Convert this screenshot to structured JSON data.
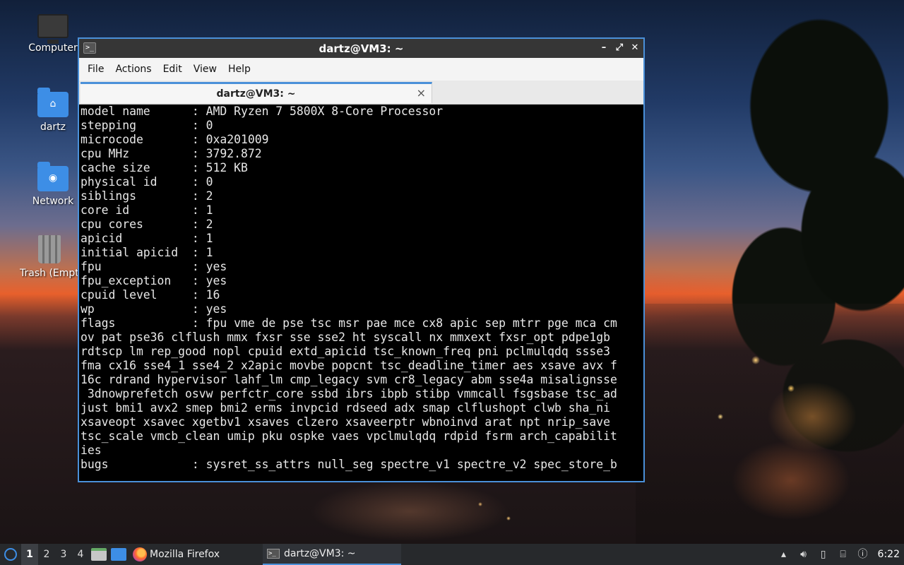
{
  "desktop": {
    "icons": [
      {
        "label": "Computer",
        "icon": "computer-icon"
      },
      {
        "label": "dartz",
        "icon": "home-folder-icon"
      },
      {
        "label": "Network",
        "icon": "network-folder-icon"
      },
      {
        "label": "Trash (Empty)",
        "icon": "trash-icon"
      }
    ]
  },
  "window": {
    "title": "dartz@VM3: ~",
    "menus": [
      "File",
      "Actions",
      "Edit",
      "View",
      "Help"
    ],
    "tab_label": "dartz@VM3: ~",
    "terminal_lines": [
      "model name      : AMD Ryzen 7 5800X 8-Core Processor",
      "stepping        : 0",
      "microcode       : 0xa201009",
      "cpu MHz         : 3792.872",
      "cache size      : 512 KB",
      "physical id     : 0",
      "siblings        : 2",
      "core id         : 1",
      "cpu cores       : 2",
      "apicid          : 1",
      "initial apicid  : 1",
      "fpu             : yes",
      "fpu_exception   : yes",
      "cpuid level     : 16",
      "wp              : yes",
      "flags           : fpu vme de pse tsc msr pae mce cx8 apic sep mtrr pge mca cm",
      "ov pat pse36 clflush mmx fxsr sse sse2 ht syscall nx mmxext fxsr_opt pdpe1gb",
      "rdtscp lm rep_good nopl cpuid extd_apicid tsc_known_freq pni pclmulqdq ssse3",
      "fma cx16 sse4_1 sse4_2 x2apic movbe popcnt tsc_deadline_timer aes xsave avx f",
      "16c rdrand hypervisor lahf_lm cmp_legacy svm cr8_legacy abm sse4a misalignsse",
      " 3dnowprefetch osvw perfctr_core ssbd ibrs ibpb stibp vmmcall fsgsbase tsc_ad",
      "just bmi1 avx2 smep bmi2 erms invpcid rdseed adx smap clflushopt clwb sha_ni",
      "xsaveopt xsavec xgetbv1 xsaves clzero xsaveerptr wbnoinvd arat npt nrip_save",
      "tsc_scale vmcb_clean umip pku ospke vaes vpclmulqdq rdpid fsrm arch_capabilit",
      "ies",
      "bugs            : sysret_ss_attrs null_seg spectre_v1 spectre_v2 spec_store_b"
    ]
  },
  "taskbar": {
    "workspaces": [
      "1",
      "2",
      "3",
      "4"
    ],
    "active_workspace": "1",
    "tasks": [
      {
        "label": "Mozilla Firefox",
        "icon": "firefox-icon"
      },
      {
        "label": "dartz@VM3: ~",
        "icon": "terminal-icon"
      }
    ],
    "clock": "6:22"
  },
  "colors": {
    "accent": "#4a90d9",
    "terminal_bg": "#000000",
    "terminal_fg": "#e8e8e8",
    "taskbar_bg": "#27292c"
  }
}
